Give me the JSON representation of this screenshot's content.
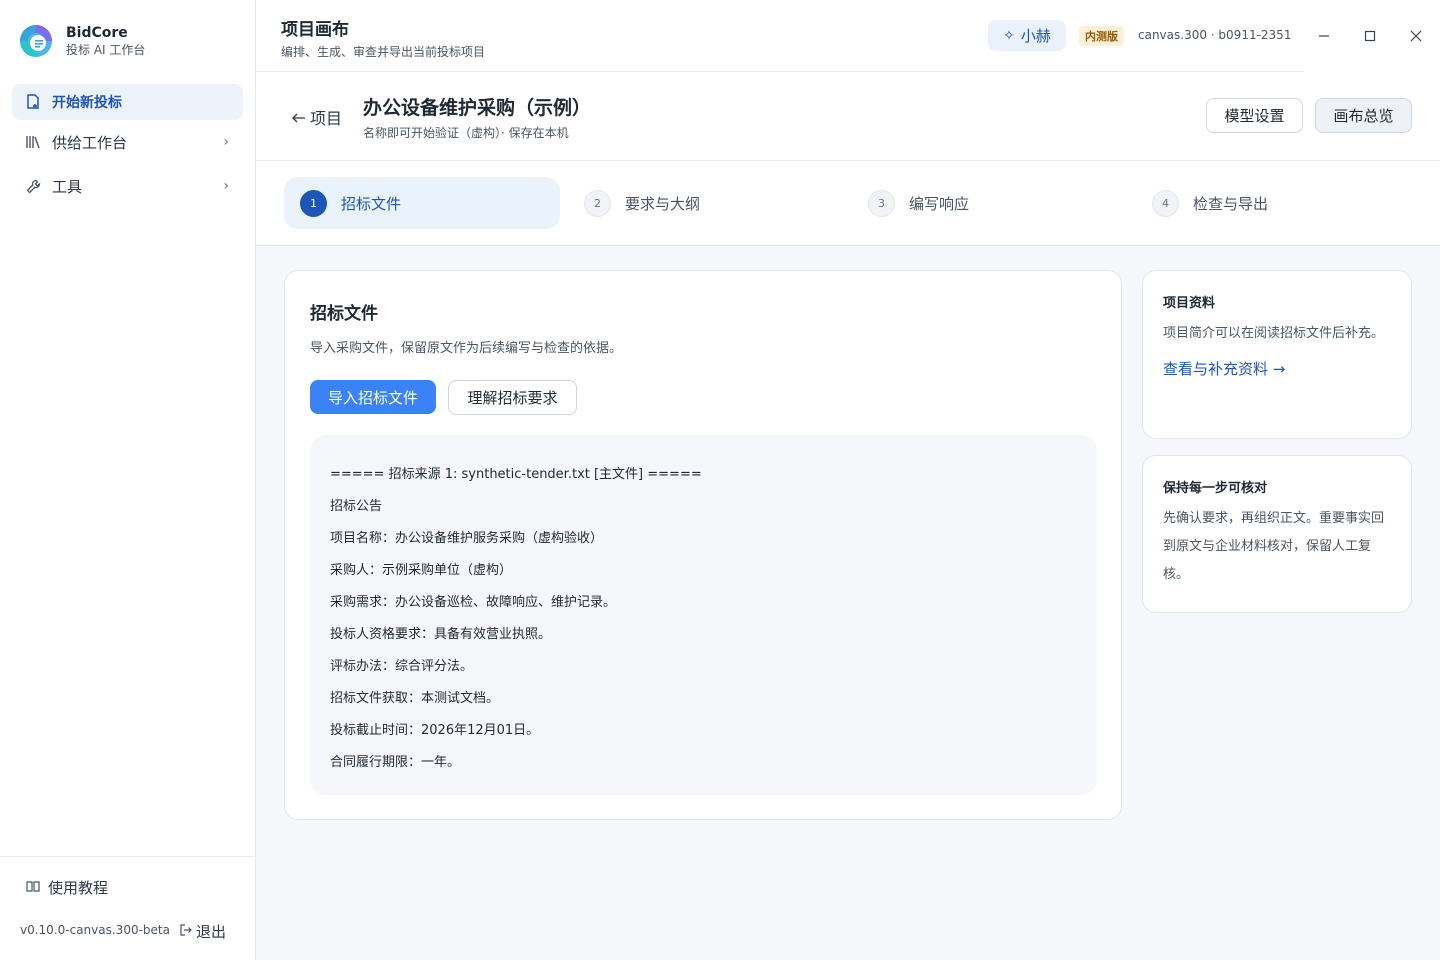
{
  "brand": {
    "name": "BidCore",
    "subtitle": "投标 AI 工作台"
  },
  "sidebar": {
    "items": [
      {
        "label": "开始新投标",
        "icon": "new-doc-icon",
        "active": true
      },
      {
        "label": "供给工作台",
        "icon": "library-icon",
        "expandable": true
      },
      {
        "label": "工具",
        "icon": "wrench-icon",
        "expandable": true
      }
    ],
    "tutorial": "使用教程",
    "version": "v0.10.0-canvas.300-beta",
    "logout": "退出"
  },
  "topbar": {
    "title": "项目画布",
    "subtitle": "编排、生成、审查并导出当前投标项目",
    "assistant": "小赫",
    "badge": "内测版",
    "build": "canvas.300 · b0911-2351"
  },
  "project": {
    "back": "项目",
    "title": "办公设备维护采购（示例）",
    "subtitle": "名称即可开始验证（虚构）· 保存在本机",
    "model_settings": "模型设置",
    "canvas_overview": "画布总览"
  },
  "steps": [
    {
      "num": "1",
      "label": "招标文件",
      "active": true
    },
    {
      "num": "2",
      "label": "要求与大纲"
    },
    {
      "num": "3",
      "label": "编写响应"
    },
    {
      "num": "4",
      "label": "检查与导出"
    }
  ],
  "main": {
    "title": "招标文件",
    "description": "导入采购文件，保留原文作为后续编写与检查的依据。",
    "import_button": "导入招标文件",
    "understand_button": "理解招标要求",
    "document_lines": [
      "===== 招标来源 1: synthetic-tender.txt [主文件] =====",
      "招标公告",
      "项目名称：办公设备维护服务采购（虚构验收）",
      "采购人：示例采购单位（虚构）",
      "采购需求：办公设备巡检、故障响应、维护记录。",
      "投标人资格要求：具备有效营业执照。",
      "评标办法：综合评分法。",
      "招标文件获取：本测试文档。",
      "投标截止时间：2026年12月01日。",
      "合同履行期限：一年。"
    ]
  },
  "side": {
    "info": {
      "title": "项目资料",
      "text": "项目简介可以在阅读招标文件后补充。",
      "link": "查看与补充资料 →"
    },
    "verify": {
      "title": "保持每一步可核对",
      "text": "先确认要求，再组织正文。重要事实回到原文与企业材料核对，保留人工复核。"
    }
  },
  "colors": {
    "accent": "#1e56b8",
    "primary_button": "#3b82f6",
    "badge_bg": "#fbf1d9",
    "badge_text": "#9a5b00"
  }
}
